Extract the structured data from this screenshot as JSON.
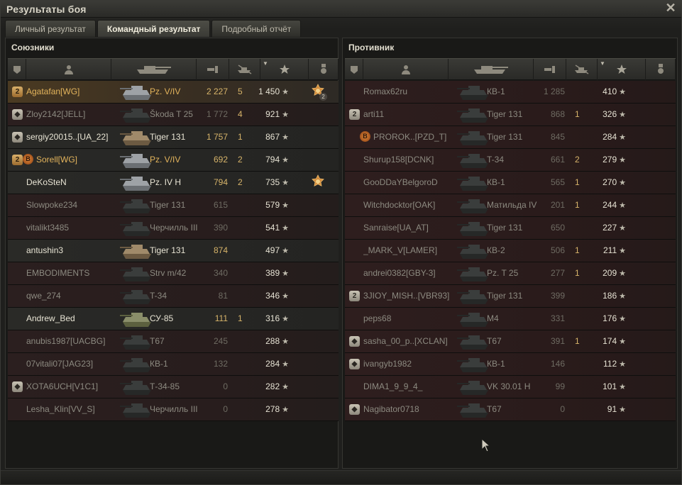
{
  "window": {
    "title": "Результаты боя"
  },
  "tabs": [
    {
      "label": "Личный результат",
      "active": false
    },
    {
      "label": "Командный результат",
      "active": true
    },
    {
      "label": "Подробный отчёт",
      "active": false
    }
  ],
  "allies": {
    "title": "Союзники",
    "rows": [
      {
        "badge": "2",
        "badge_type": "plat",
        "medal": "",
        "name": "Agatafan[WG]",
        "name_style": "gold",
        "tank": "Pz. V/IV",
        "tank_style": "gold",
        "damage": "2 227",
        "damage_style": "hi",
        "kills": "5",
        "xp": "1 450",
        "achievement": "medal-icon",
        "achievement_count": "2",
        "row_style": "hl",
        "tank_color": "grey"
      },
      {
        "badge": "",
        "badge_type": "shield",
        "medal": "",
        "name": "Zloy2142[JELL]",
        "name_style": "dead",
        "tank": "Škoda T 25",
        "tank_style": "dead",
        "damage": "1 772",
        "damage_style": "lo",
        "kills": "4",
        "xp": "921",
        "achievement": "",
        "achievement_count": "",
        "row_style": "dead",
        "tank_color": "dark"
      },
      {
        "badge": "",
        "badge_type": "shield",
        "medal": "",
        "name": "sergiy20015..[UA_22]",
        "name_style": "alive",
        "tank": "Tiger 131",
        "tank_style": "alive",
        "damage": "1 757",
        "damage_style": "hi",
        "kills": "1",
        "xp": "867",
        "achievement": "",
        "achievement_count": "",
        "row_style": "alive",
        "tank_color": "camo"
      },
      {
        "badge": "2",
        "badge_type": "plat",
        "medal": "B",
        "name": "Sorell[WG]",
        "name_style": "gold",
        "tank": "Pz. V/IV",
        "tank_style": "gold",
        "damage": "692",
        "damage_style": "hi",
        "kills": "2",
        "xp": "794",
        "achievement": "",
        "achievement_count": "",
        "row_style": "alive",
        "tank_color": "grey"
      },
      {
        "badge": "",
        "badge_type": "",
        "medal": "",
        "name": "DeKoSteN",
        "name_style": "alive",
        "tank": "Pz. IV H",
        "tank_style": "alive",
        "damage": "794",
        "damage_style": "hi",
        "kills": "2",
        "xp": "735",
        "achievement": "medal-icon",
        "achievement_count": "",
        "row_style": "alive",
        "tank_color": "grey"
      },
      {
        "badge": "",
        "badge_type": "",
        "medal": "",
        "name": "Slowpoke234",
        "name_style": "dead",
        "tank": "Tiger 131",
        "tank_style": "dead",
        "damage": "615",
        "damage_style": "lo",
        "kills": "",
        "xp": "579",
        "achievement": "",
        "achievement_count": "",
        "row_style": "dead",
        "tank_color": "dark"
      },
      {
        "badge": "",
        "badge_type": "",
        "medal": "",
        "name": "vitalikt3485",
        "name_style": "dead",
        "tank": "Черчилль III",
        "tank_style": "dead",
        "damage": "390",
        "damage_style": "lo",
        "kills": "",
        "xp": "541",
        "achievement": "",
        "achievement_count": "",
        "row_style": "dead",
        "tank_color": "dark"
      },
      {
        "badge": "",
        "badge_type": "",
        "medal": "",
        "name": "antushin3",
        "name_style": "alive",
        "tank": "Tiger 131",
        "tank_style": "alive",
        "damage": "874",
        "damage_style": "hi",
        "kills": "",
        "xp": "497",
        "achievement": "",
        "achievement_count": "",
        "row_style": "alive",
        "tank_color": "camo"
      },
      {
        "badge": "",
        "badge_type": "",
        "medal": "",
        "name": "EMBODIMENTS",
        "name_style": "dead",
        "tank": "Strv m/42",
        "tank_style": "dead",
        "damage": "340",
        "damage_style": "lo",
        "kills": "",
        "xp": "389",
        "achievement": "",
        "achievement_count": "",
        "row_style": "dead",
        "tank_color": "dark"
      },
      {
        "badge": "",
        "badge_type": "",
        "medal": "",
        "name": "qwe_274",
        "name_style": "dead",
        "tank": "T-34",
        "tank_style": "dead",
        "damage": "81",
        "damage_style": "lo",
        "kills": "",
        "xp": "346",
        "achievement": "",
        "achievement_count": "",
        "row_style": "dead",
        "tank_color": "dark"
      },
      {
        "badge": "",
        "badge_type": "",
        "medal": "",
        "name": "Andrew_Bed",
        "name_style": "alive",
        "tank": "СУ-85",
        "tank_style": "alive",
        "damage": "111",
        "damage_style": "hi",
        "kills": "1",
        "xp": "316",
        "achievement": "",
        "achievement_count": "",
        "row_style": "alive",
        "tank_color": "green"
      },
      {
        "badge": "",
        "badge_type": "",
        "medal": "",
        "name": "anubis1987[UACBG]",
        "name_style": "dead",
        "tank": "T67",
        "tank_style": "dead",
        "damage": "245",
        "damage_style": "lo",
        "kills": "",
        "xp": "288",
        "achievement": "",
        "achievement_count": "",
        "row_style": "dead",
        "tank_color": "dark"
      },
      {
        "badge": "",
        "badge_type": "",
        "medal": "",
        "name": "07vitali07[JAG23]",
        "name_style": "dead",
        "tank": "КВ-1",
        "tank_style": "dead",
        "damage": "132",
        "damage_style": "lo",
        "kills": "",
        "xp": "284",
        "achievement": "",
        "achievement_count": "",
        "row_style": "dead",
        "tank_color": "dark"
      },
      {
        "badge": "",
        "badge_type": "shield",
        "medal": "",
        "name": "XOTA6UCH[V1C1]",
        "name_style": "dead",
        "tank": "Т-34-85",
        "tank_style": "dead",
        "damage": "0",
        "damage_style": "lo",
        "kills": "",
        "xp": "282",
        "achievement": "",
        "achievement_count": "",
        "row_style": "dead",
        "tank_color": "dark"
      },
      {
        "badge": "",
        "badge_type": "",
        "medal": "",
        "name": "Lesha_Klin[VV_S]",
        "name_style": "dead",
        "tank": "Черчилль III",
        "tank_style": "dead",
        "damage": "0",
        "damage_style": "lo",
        "kills": "",
        "xp": "278",
        "achievement": "",
        "achievement_count": "",
        "row_style": "dead",
        "tank_color": "dark"
      }
    ]
  },
  "enemies": {
    "title": "Противник",
    "rows": [
      {
        "badge": "",
        "badge_type": "",
        "medal": "",
        "name": "Romax62ru",
        "name_style": "dead",
        "tank": "КВ-1",
        "tank_style": "dead",
        "damage": "1 285",
        "damage_style": "lo",
        "kills": "",
        "xp": "410"
      },
      {
        "badge": "2",
        "badge_type": "plain",
        "medal": "",
        "name": "arti11",
        "name_style": "dead",
        "tank": "Tiger 131",
        "tank_style": "dead",
        "damage": "868",
        "damage_style": "lo",
        "kills": "1",
        "xp": "326"
      },
      {
        "badge": "",
        "badge_type": "",
        "medal": "B",
        "name": "PROROK..[PZD_T]",
        "name_style": "dead",
        "tank": "Tiger 131",
        "tank_style": "dead",
        "damage": "845",
        "damage_style": "lo",
        "kills": "",
        "xp": "284"
      },
      {
        "badge": "",
        "badge_type": "",
        "medal": "",
        "name": "Shurup158[DCNK]",
        "name_style": "dead",
        "tank": "T-34",
        "tank_style": "dead",
        "damage": "661",
        "damage_style": "lo",
        "kills": "2",
        "xp": "279"
      },
      {
        "badge": "",
        "badge_type": "",
        "medal": "",
        "name": "GooDDaYBelgoroD",
        "name_style": "dead",
        "tank": "КВ-1",
        "tank_style": "dead",
        "damage": "565",
        "damage_style": "lo",
        "kills": "1",
        "xp": "270"
      },
      {
        "badge": "",
        "badge_type": "",
        "medal": "",
        "name": "Witchdocktor[OAK]",
        "name_style": "dead",
        "tank": "Матильда IV",
        "tank_style": "dead",
        "damage": "201",
        "damage_style": "lo",
        "kills": "1",
        "xp": "244"
      },
      {
        "badge": "",
        "badge_type": "",
        "medal": "",
        "name": "Sanraise[UA_AT]",
        "name_style": "dead",
        "tank": "Tiger 131",
        "tank_style": "dead",
        "damage": "650",
        "damage_style": "lo",
        "kills": "",
        "xp": "227"
      },
      {
        "badge": "",
        "badge_type": "",
        "medal": "",
        "name": "_MARK_V[LAMER]",
        "name_style": "dead",
        "tank": "КВ-2",
        "tank_style": "dead",
        "damage": "506",
        "damage_style": "lo",
        "kills": "1",
        "xp": "211"
      },
      {
        "badge": "",
        "badge_type": "",
        "medal": "",
        "name": "andrei0382[GBY-3]",
        "name_style": "dead",
        "tank": "Pz. T 25",
        "tank_style": "dead",
        "damage": "277",
        "damage_style": "lo",
        "kills": "1",
        "xp": "209"
      },
      {
        "badge": "2",
        "badge_type": "plain",
        "medal": "",
        "name": "3JIOY_MISH..[VBR93]",
        "name_style": "dead",
        "tank": "Tiger 131",
        "tank_style": "dead",
        "damage": "399",
        "damage_style": "lo",
        "kills": "",
        "xp": "186"
      },
      {
        "badge": "",
        "badge_type": "",
        "medal": "",
        "name": "peps68",
        "name_style": "dead",
        "tank": "M4",
        "tank_style": "dead",
        "damage": "331",
        "damage_style": "lo",
        "kills": "",
        "xp": "176"
      },
      {
        "badge": "",
        "badge_type": "shield",
        "medal": "",
        "name": "sasha_00_p..[XCLAN]",
        "name_style": "dead",
        "tank": "T67",
        "tank_style": "dead",
        "damage": "391",
        "damage_style": "lo",
        "kills": "1",
        "xp": "174"
      },
      {
        "badge": "",
        "badge_type": "shield",
        "medal": "",
        "name": "ivangyb1982",
        "name_style": "dead",
        "tank": "КВ-1",
        "tank_style": "dead",
        "damage": "146",
        "damage_style": "lo",
        "kills": "",
        "xp": "112"
      },
      {
        "badge": "",
        "badge_type": "",
        "medal": "",
        "name": "DIMA1_9_9_4_",
        "name_style": "dead",
        "tank": "VK 30.01 H",
        "tank_style": "dead",
        "damage": "99",
        "damage_style": "lo",
        "kills": "",
        "xp": "101"
      },
      {
        "badge": "",
        "badge_type": "shield",
        "medal": "",
        "name": "Nagibator0718",
        "name_style": "dead",
        "tank": "T67",
        "tank_style": "dead",
        "damage": "0",
        "damage_style": "lo",
        "kills": "",
        "xp": "91"
      }
    ]
  },
  "columns": [
    {
      "icon": "badge-column-icon"
    },
    {
      "icon": "player-column-icon"
    },
    {
      "icon": "tank-column-icon"
    },
    {
      "icon": "damage-column-icon"
    },
    {
      "icon": "kills-column-icon"
    },
    {
      "icon": "xp-column-icon",
      "sorted": true
    },
    {
      "icon": "achievements-column-icon"
    }
  ],
  "colors": {
    "gold": "#e3b45c",
    "alive_text": "#e8e4d4",
    "dead_text": "#8c8a80",
    "ally_row_dead": "#281d1d",
    "enemy_row": "#2a1b1b"
  }
}
